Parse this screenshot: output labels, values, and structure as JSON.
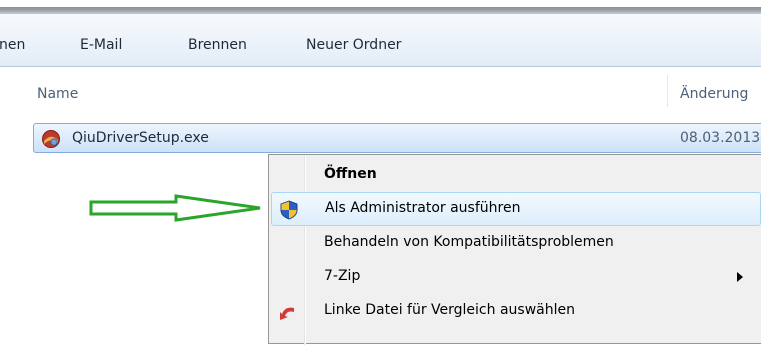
{
  "toolbar": {
    "items": [
      "nen",
      "E-Mail",
      "Brennen",
      "Neuer Ordner"
    ]
  },
  "columns": {
    "name": "Name",
    "date": "Änderung"
  },
  "file": {
    "name": "QiuDriverSetup.exe",
    "date": "08.03.2013",
    "icon": "installer-icon"
  },
  "context_menu": {
    "items": [
      {
        "label": "Öffnen",
        "bold": true
      },
      {
        "label": "Als Administrator ausführen",
        "icon": "uac-shield-icon",
        "highlighted": true
      },
      {
        "label": "Behandeln von Kompatibilitätsproblemen"
      },
      {
        "label": "7-Zip",
        "submenu": true
      },
      {
        "label": "Linke Datei für Vergleich auswählen",
        "icon": "undo-arrow-icon"
      }
    ]
  },
  "colors": {
    "selection_border": "#84acdd",
    "highlight_border": "#a8d8f7",
    "arrow": "#2aa52a",
    "shield_blue": "#2b5fc4",
    "shield_yellow": "#f1c232",
    "undo_red": "#d23a3a"
  }
}
